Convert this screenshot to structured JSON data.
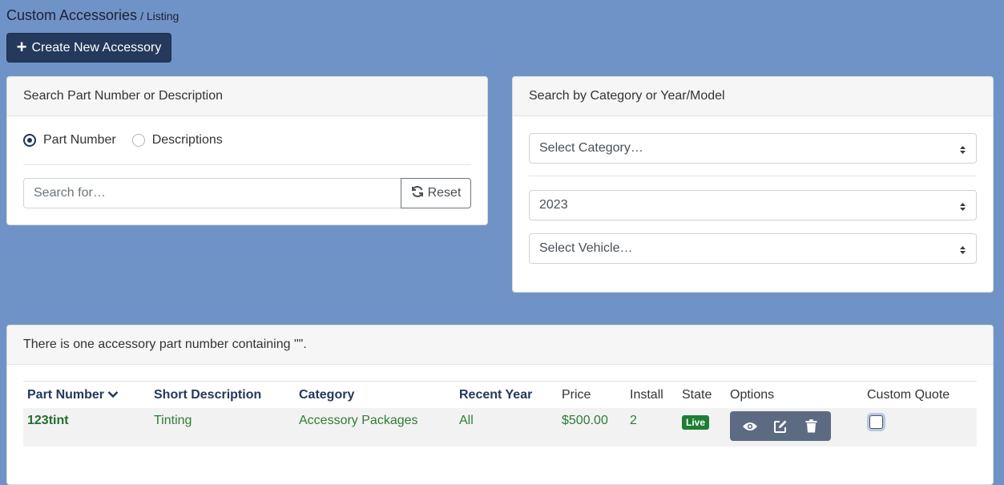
{
  "breadcrumb": {
    "title": "Custom Accessories",
    "sub": "/ Listing"
  },
  "create_button": {
    "label": "Create New Accessory"
  },
  "search_card": {
    "header": "Search Part Number or Description",
    "radio_part": "Part Number",
    "radio_desc": "Descriptions",
    "selected": "Part Number",
    "search_placeholder": "Search for…",
    "search_value": "",
    "reset_label": "Reset"
  },
  "filter_card": {
    "header": "Search by Category or Year/Model",
    "category_select": "Select Category…",
    "year_select": "2023",
    "vehicle_select": "Select Vehicle…"
  },
  "results": {
    "message": "There is one accessory part number containing \"\".",
    "columns": {
      "part_number": "Part Number",
      "short_description": "Short Description",
      "category": "Category",
      "recent_year": "Recent Year",
      "price": "Price",
      "install": "Install",
      "state": "State",
      "options": "Options",
      "custom_quote": "Custom Quote"
    },
    "rows": [
      {
        "part_number": "123tint",
        "short_description": "Tinting",
        "category": "Accessory Packages",
        "recent_year": "All",
        "price": "$500.00",
        "install": "2",
        "state": "Live"
      }
    ]
  },
  "colors": {
    "background": "#6f93c7",
    "primary": "#24395c",
    "success": "#1e7e34",
    "link_green": "#2e7d32"
  }
}
